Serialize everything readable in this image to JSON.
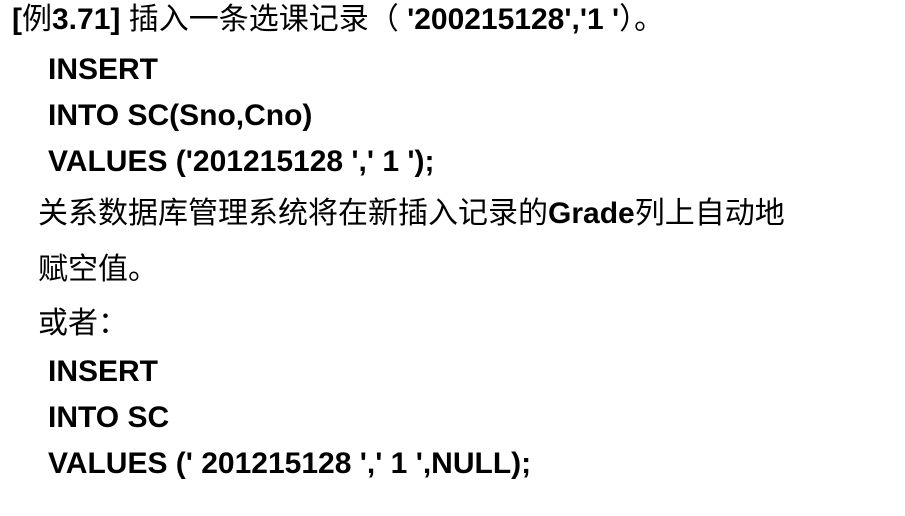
{
  "example": {
    "open_bracket": "[",
    "prefix": "例",
    "number": "3.71]",
    "description": " 插入一条选课记录（ ",
    "values": "'200215128','1 '",
    "closing": "）。"
  },
  "query1": {
    "line1": "INSERT",
    "line2": "INTO SC(Sno,Cno)",
    "line3": "VALUES ('201215128 ',' 1 ');"
  },
  "explanation": {
    "part1": "关系数据库管理系统将在新插入记录的",
    "column": "Grade",
    "part2": "列上自动地",
    "line2": "赋空值。"
  },
  "alternative_label": "或者：",
  "query2": {
    "line1": "INSERT",
    "line2": "INTO SC",
    "line3": "VALUES (' 201215128 ',' 1 ',NULL);"
  }
}
